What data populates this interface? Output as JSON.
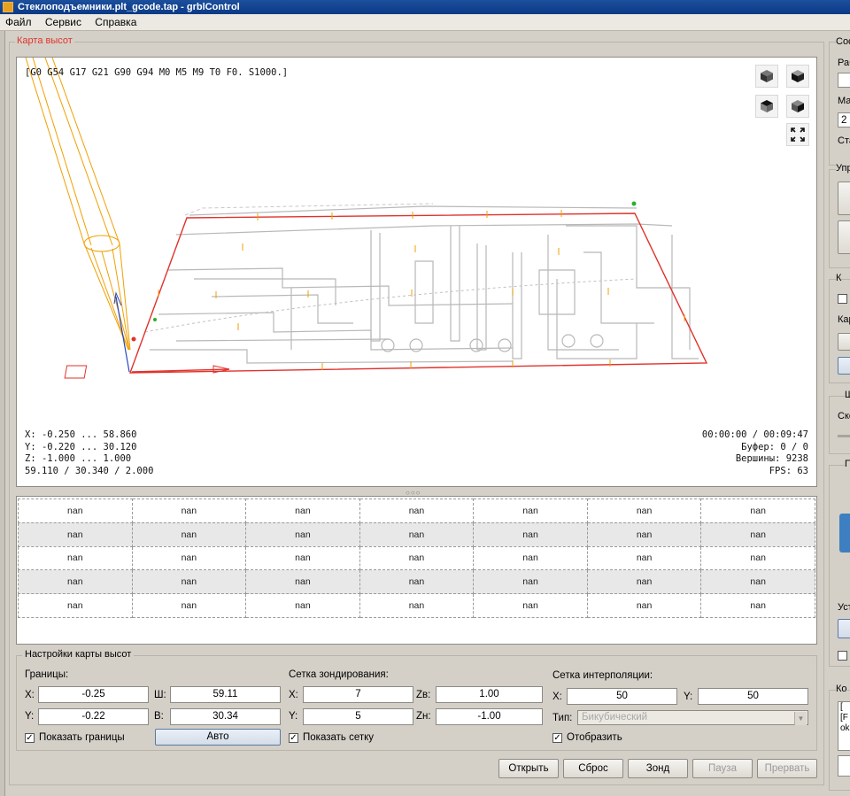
{
  "window": {
    "title": "Стеклоподъемники.plt_gcode.tap - grblControl"
  },
  "menu": [
    "Файл",
    "Сервис",
    "Справка"
  ],
  "heightmap": {
    "group_title": "Карта высот",
    "gcode_state": "[G0 G54 G17 G21 G90 G94 M0 M5 M9 T0 F0. S1000.]",
    "coords": {
      "x": "X: -0.250 ... 58.860",
      "y": "Y: -0.220 ... 30.120",
      "z": "Z: -1.000 ... 1.000",
      "size": "59.110 / 30.340 / 2.000"
    },
    "stats": {
      "time": "00:00:00 / 00:09:47",
      "buffer": "Буфер: 0 / 0",
      "vertices": "Вершины: 9238",
      "fps": "FPS: 63"
    },
    "icons": [
      "cube-iso-icon",
      "cube-front-icon",
      "cube-top-icon",
      "cube-left-icon",
      "fit-view-icon"
    ]
  },
  "table": {
    "rows": [
      [
        "nan",
        "nan",
        "nan",
        "nan",
        "nan",
        "nan",
        "nan"
      ],
      [
        "nan",
        "nan",
        "nan",
        "nan",
        "nan",
        "nan",
        "nan"
      ],
      [
        "nan",
        "nan",
        "nan",
        "nan",
        "nan",
        "nan",
        "nan"
      ],
      [
        "nan",
        "nan",
        "nan",
        "nan",
        "nan",
        "nan",
        "nan"
      ],
      [
        "nan",
        "nan",
        "nan",
        "nan",
        "nan",
        "nan",
        "nan"
      ]
    ]
  },
  "settings": {
    "title": "Настройки карты высот",
    "bounds": {
      "label": "Границы:",
      "x_label": "X:",
      "x_value": "-0.25",
      "w_label": "Ш:",
      "w_value": "59.11",
      "y_label": "Y:",
      "y_value": "-0.22",
      "h_label": "В:",
      "h_value": "30.34",
      "show_label": "Показать границы",
      "show_checked": true,
      "auto_button": "Авто"
    },
    "probe_grid": {
      "label": "Сетка зондирования:",
      "x_label": "X:",
      "x_value": "7",
      "zt_label": "Zв:",
      "zt_value": "1.00",
      "y_label": "Y:",
      "y_value": "5",
      "zb_label": "Zн:",
      "zb_value": "-1.00",
      "show_label": "Показать сетку",
      "show_checked": true
    },
    "interp_grid": {
      "label": "Сетка интерполяции:",
      "x_label": "X:",
      "x_value": "50",
      "y_label": "Y:",
      "y_value": "50",
      "type_label": "Тип:",
      "type_value": "Бикубический",
      "show_label": "Отобразить",
      "show_checked": true
    }
  },
  "actions": {
    "open": "Открыть",
    "reset": "Сброс",
    "probe": "Зонд",
    "pause": "Пауза",
    "abort": "Прервать"
  },
  "right_panel": {
    "texts": [
      "Сос",
      "Раб",
      "Ма",
      "2",
      "Ста",
      "Упр",
      "К",
      "Кар",
      "Ш",
      "Ско",
      "П",
      "Уст",
      "Ко",
      "[",
      "[F",
      "ok"
    ]
  },
  "colors": {
    "accent_red": "#e0322b",
    "tool_orange": "#f0a000",
    "window_bg": "#d4d0c8",
    "title_blue": "#0a3a86"
  }
}
